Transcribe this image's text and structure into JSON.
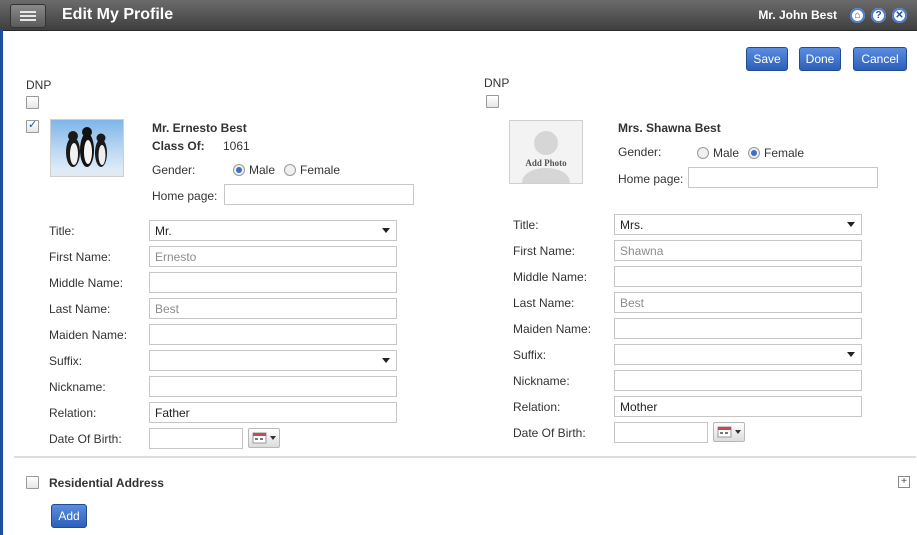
{
  "window": {
    "title": "Edit My Profile",
    "user": "Mr. John Best"
  },
  "toolbar": {
    "save_label": "Save",
    "done_label": "Done",
    "cancel_label": "Cancel"
  },
  "left": {
    "dnp_label": "DNP",
    "full_name": "Mr. Ernesto Best",
    "class_of_label": "Class Of:",
    "class_of_value": "1061",
    "gender_label": "Gender:",
    "gender_male": "Male",
    "gender_female": "Female",
    "gender_selected": "Male",
    "homepage_label": "Home page:",
    "homepage_value": "",
    "fields": {
      "title_label": "Title:",
      "title_value": "Mr.",
      "first_label": "First Name:",
      "first_value": "Ernesto",
      "middle_label": "Middle Name:",
      "middle_value": "",
      "last_label": "Last Name:",
      "last_value": "Best",
      "maiden_label": "Maiden Name:",
      "maiden_value": "",
      "suffix_label": "Suffix:",
      "suffix_value": "",
      "nickname_label": "Nickname:",
      "nickname_value": "",
      "relation_label": "Relation:",
      "relation_value": "Father",
      "dob_label": "Date Of Birth:",
      "dob_value": ""
    }
  },
  "right": {
    "dnp_label": "DNP",
    "full_name": "Mrs. Shawna Best",
    "add_photo_label": "Add Photo",
    "gender_label": "Gender:",
    "gender_male": "Male",
    "gender_female": "Female",
    "gender_selected": "Female",
    "homepage_label": "Home page:",
    "homepage_value": "",
    "fields": {
      "title_label": "Title:",
      "title_value": "Mrs.",
      "first_label": "First Name:",
      "first_value": "Shawna",
      "middle_label": "Middle Name:",
      "middle_value": "",
      "last_label": "Last Name:",
      "last_value": "Best",
      "maiden_label": "Maiden Name:",
      "maiden_value": "",
      "suffix_label": "Suffix:",
      "suffix_value": "",
      "nickname_label": "Nickname:",
      "nickname_value": "",
      "relation_label": "Relation:",
      "relation_value": "Mother",
      "dob_label": "Date Of Birth:",
      "dob_value": ""
    }
  },
  "address": {
    "section_label": "Residential Address",
    "add_label": "Add"
  },
  "colors": {
    "accent": "#2c5fb9",
    "titlebar": "#4a4a4a"
  },
  "icons": {
    "menu": "menu-icon",
    "home": "home-icon",
    "help": "help-icon",
    "close": "close-icon",
    "calendar": "calendar-icon",
    "expand": "expand-icon"
  }
}
